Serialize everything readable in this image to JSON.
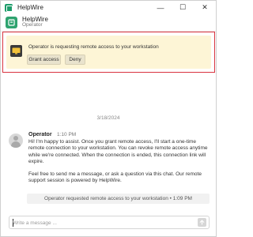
{
  "window": {
    "title": "HelpWire",
    "controls": {
      "minimize": "—",
      "maximize": "☐",
      "close": "✕"
    }
  },
  "header": {
    "name": "HelpWire",
    "role": "Operator"
  },
  "alert": {
    "text": "Operator is requesting remote access to your workstation",
    "grant_label": "Grant access",
    "deny_label": "Deny",
    "icon": "monitor-icon",
    "background": "#fdf5d6",
    "highlight_border": "#d9333f"
  },
  "chat": {
    "date": "3/18/2024",
    "message": {
      "sender": "Operator",
      "time": "1:10 PM",
      "paragraph1": "Hi! I'm happy to assist. Once you grant remote access, I'll start a one-time remote connection to your workstation. You can revoke remote access anytime while we're connected. When the connection is ended, this connection link will expire.",
      "paragraph2": "Feel free to send me a message, or ask a question via this chat. Our remote support session is powered by HelpWire."
    },
    "system_notice": "Operator requested remote access to your workstation • 1:09 PM"
  },
  "composer": {
    "placeholder": "Write a message ...",
    "value": ""
  },
  "colors": {
    "brand": "#2fa36f",
    "border": "#cfcfcf"
  }
}
